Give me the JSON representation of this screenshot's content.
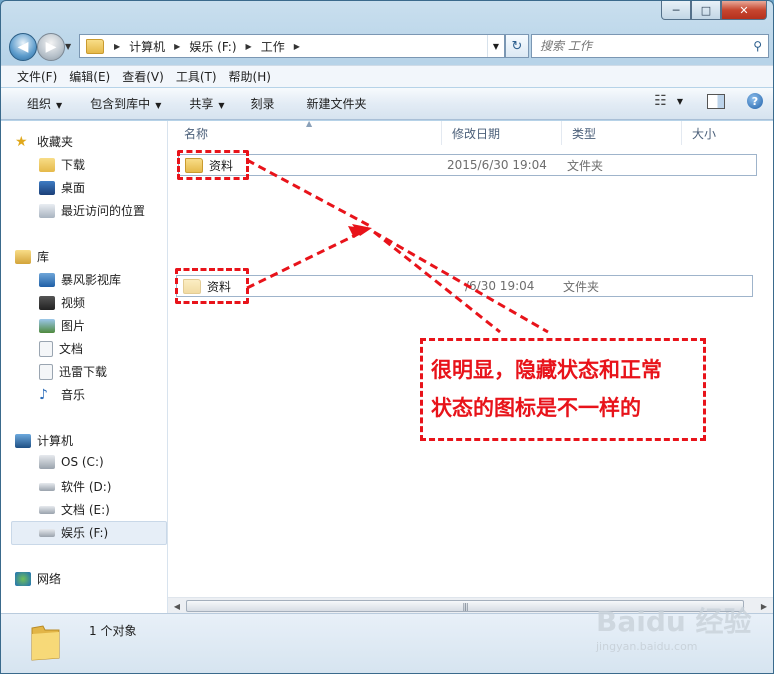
{
  "window": {
    "minimize": "─",
    "maximize": "□",
    "close": "✕"
  },
  "address": {
    "segments": [
      "计算机",
      "娱乐 (F:)",
      "工作"
    ]
  },
  "search": {
    "placeholder": "搜索 工作"
  },
  "menu": [
    "文件(F)",
    "编辑(E)",
    "查看(V)",
    "工具(T)",
    "帮助(H)"
  ],
  "toolbar": {
    "organize": "组织",
    "include": "包含到库中",
    "share": "共享",
    "burn": "刻录",
    "new_folder": "新建文件夹"
  },
  "navpane": {
    "favorites": "收藏夹",
    "downloads": "下载",
    "desktop": "桌面",
    "recent": "最近访问的位置",
    "libraries": "库",
    "storm": "暴风影视库",
    "videos": "视频",
    "pictures": "图片",
    "documents": "文档",
    "thunder": "迅雷下载",
    "music": "音乐",
    "computer": "计算机",
    "drive_c": "OS (C:)",
    "drive_d": "软件 (D:)",
    "drive_e": "文档 (E:)",
    "drive_f": "娱乐 (F:)",
    "network": "网络"
  },
  "columns": {
    "name": "名称",
    "date": "修改日期",
    "type": "类型",
    "size": "大小"
  },
  "files": [
    {
      "name": "资料",
      "date": "2015/6/30 19:04",
      "type": "文件夹",
      "hidden": false
    },
    {
      "name": "资料",
      "date": "/6/30 19:04",
      "type": "文件夹",
      "hidden": true
    }
  ],
  "status": {
    "count": "1 个对象"
  },
  "annotation": {
    "line1": "很明显，隐藏状态和正常",
    "line2": "状态的图标是不一样的"
  },
  "watermark": {
    "main": "Baidu 经验",
    "sub": "jingyan.baidu.com"
  },
  "colors": {
    "annotation": "#e8131a",
    "folder": "#e5b94a"
  }
}
